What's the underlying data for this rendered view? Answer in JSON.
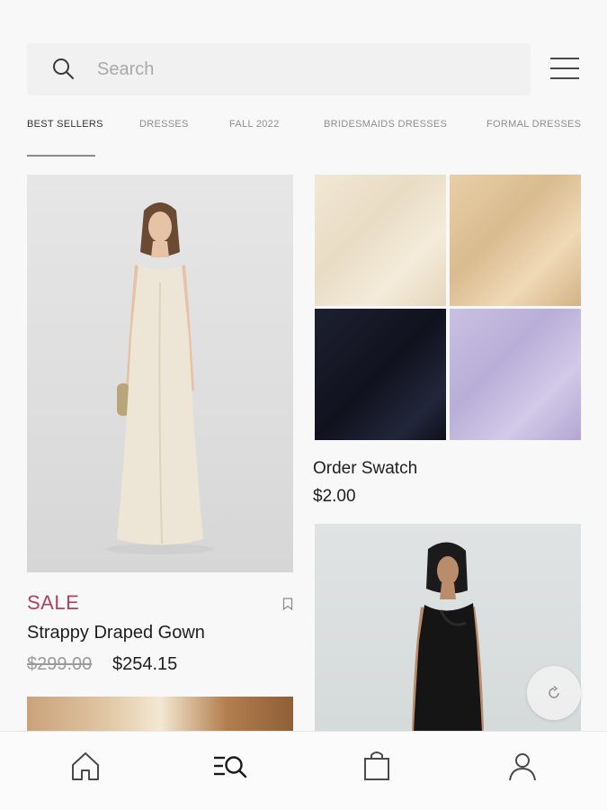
{
  "search": {
    "placeholder": "Search"
  },
  "tabs": [
    {
      "label": "BEST SELLERS",
      "active": true
    },
    {
      "label": "DRESSES",
      "active": false
    },
    {
      "label": "FALL 2022",
      "active": false
    },
    {
      "label": "BRIDESMAIDS DRESSES",
      "active": false
    },
    {
      "label": "FORMAL DRESSES",
      "active": false
    }
  ],
  "products": {
    "featured": {
      "badge": "SALE",
      "name": "Strappy Draped Gown",
      "original_price": "$299.00",
      "sale_price": "$254.15",
      "badge_color": "#b0425e"
    },
    "swatch": {
      "name": "Order Swatch",
      "price": "$2.00",
      "colors": [
        "#ede2ce",
        "#dfc49b",
        "#151827",
        "#c4bade"
      ]
    }
  },
  "icons": {
    "search": "search-icon",
    "menu": "hamburger-menu-icon",
    "bookmark": "bookmark-icon",
    "refresh": "refresh-icon",
    "home": "home-icon",
    "browse": "browse-search-icon",
    "bag": "shopping-bag-icon",
    "account": "account-icon"
  }
}
